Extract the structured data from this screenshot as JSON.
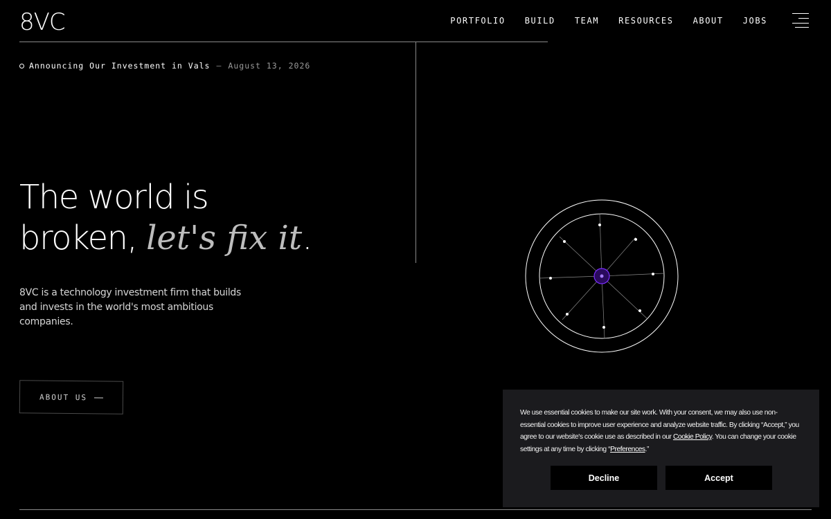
{
  "header": {
    "logo": "8VC",
    "nav": [
      "PORTFOLIO",
      "BUILD",
      "TEAM",
      "RESOURCES",
      "ABOUT",
      "JOBS"
    ]
  },
  "announcement": {
    "link_text": "Announcing Our Investment in Vals",
    "separator": "—",
    "date": "August 13, 2026"
  },
  "hero": {
    "headline_line1": "The world is",
    "headline_line2_regular": "broken, ",
    "headline_line2_italic": "let's fix it",
    "headline_period": ".",
    "description": "8VC is a technology investment firm that builds and invests in the world's most ambitious companies.",
    "cta_label": "ABOUT US"
  },
  "cookie_banner": {
    "text_before_policy": "We use essential cookies to make our site work. With your consent, we may also use non-essential cookies to improve user experience and analyze website traffic. By clicking “Accept,” you agree to our website's cookie use as described in our ",
    "policy_link": "Cookie Policy",
    "text_middle": ". You can change your cookie settings at any time by clicking “",
    "preferences_link": "Preferences",
    "text_end": ".”",
    "decline_label": "Decline",
    "accept_label": "Accept"
  },
  "colors": {
    "background": "#000000",
    "text": "#ffffff",
    "muted": "#9a9a9a",
    "cookie_bg": "#1b1b1e",
    "hub_accent": "#7b2cff"
  },
  "icons": [
    "menu-icon",
    "arrow-right-icon",
    "announcement-dot-icon"
  ]
}
